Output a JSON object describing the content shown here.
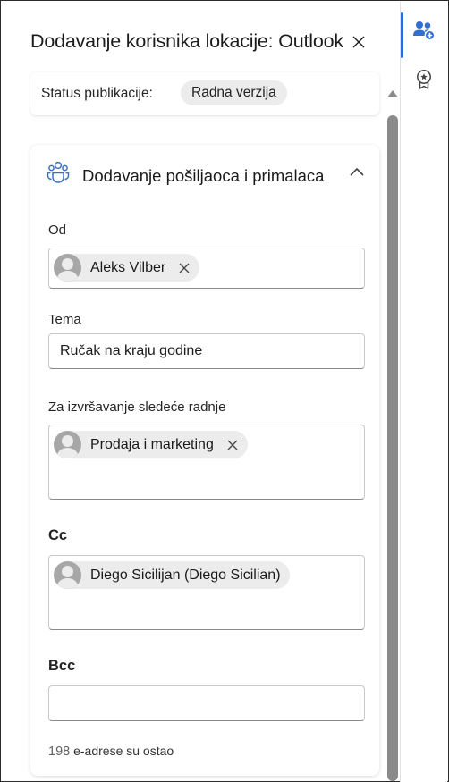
{
  "header": {
    "title": "Dodavanje korisnika lokacije: Outlook"
  },
  "status": {
    "label": "Status publikacije:",
    "value": "Radna verzija"
  },
  "section": {
    "title": "Dodavanje pošiljaoca i primalaca",
    "expanded": true
  },
  "fields": {
    "from": {
      "label": "Od",
      "chip_name": "Aleks Vilber"
    },
    "subject": {
      "label": "Tema",
      "value": "Ručak na kraju godine"
    },
    "action": {
      "label": "Za izvršavanje sledeće radnje",
      "chip_name": "Prodaja i marketing"
    },
    "cc": {
      "label": "Cc",
      "chip_name": "Diego Sicilijan (Diego Sicilian)"
    },
    "bcc": {
      "label": "Bcc",
      "value": ""
    }
  },
  "footer": {
    "count": "198",
    "text": "e-adrese su ostao"
  },
  "rail": {
    "items": [
      "people-add-icon",
      "ribbon-star-icon"
    ],
    "active_index": 0
  },
  "colors": {
    "accent": "#2f6fd1",
    "chip_bg": "#ececec",
    "scrollbar": "#8a8a8a"
  }
}
